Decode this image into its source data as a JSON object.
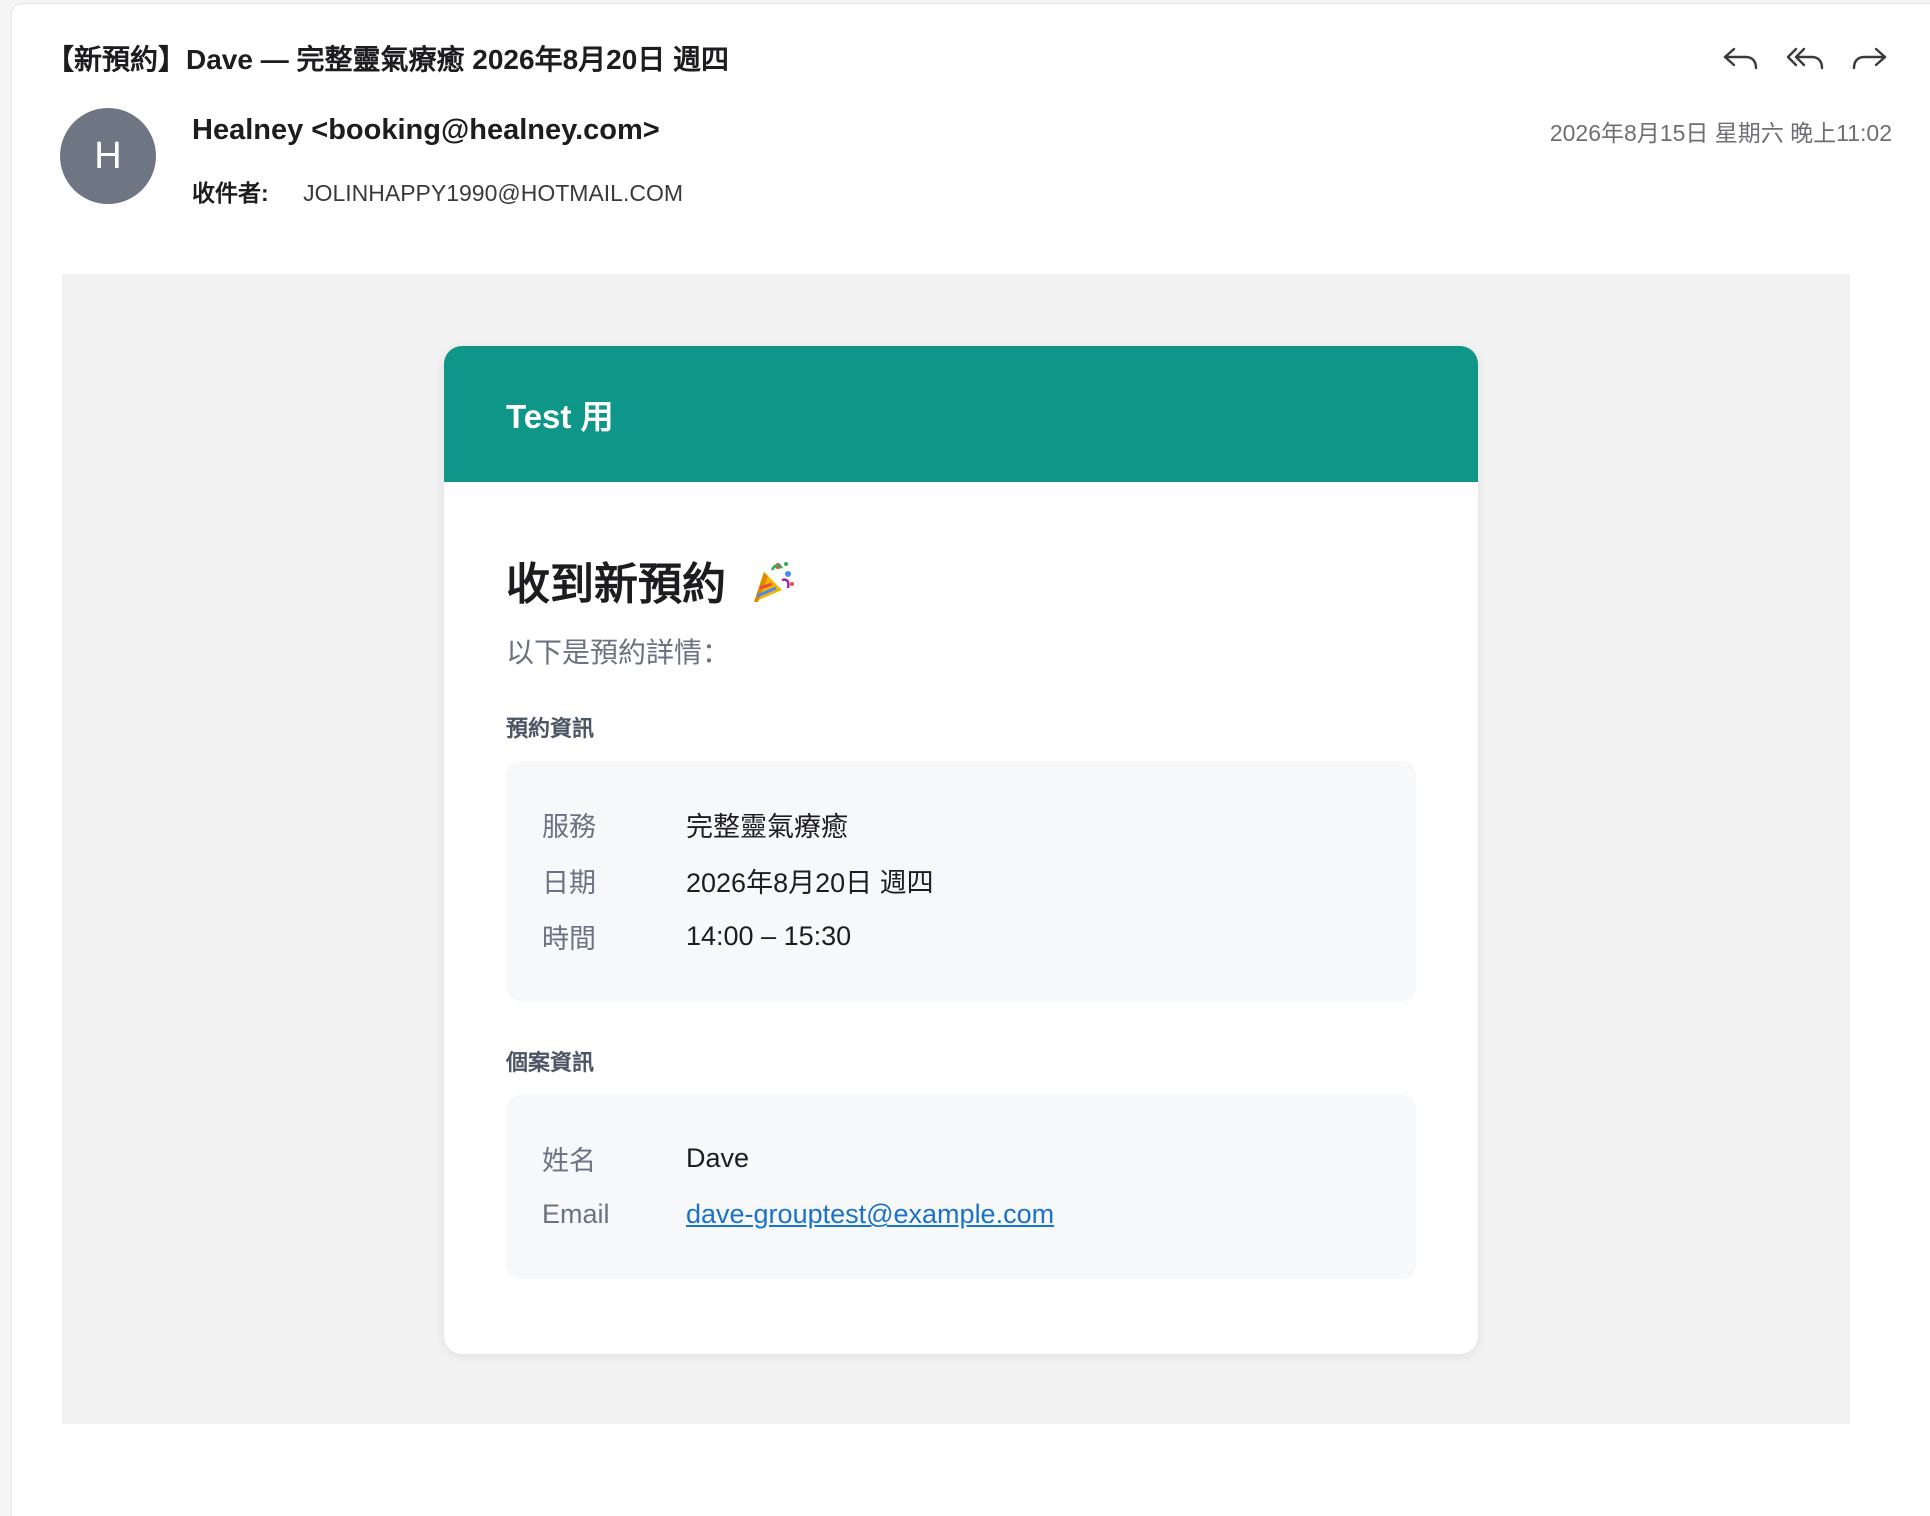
{
  "email": {
    "subject": "【新預約】Dave — 完整靈氣療癒 2026年8月20日 週四",
    "sender_initial": "H",
    "from": "Healney <booking@healney.com>",
    "to_label": "收件者:",
    "to_value": "JOLINHAPPY1990@HOTMAIL.COM",
    "datetime": "2026年8月15日 星期六 晚上11:02",
    "actions": [
      "reply-icon",
      "reply-all-icon",
      "forward-icon"
    ]
  },
  "card": {
    "header_title": "Test 用",
    "header_color": "#0e9688",
    "heading": "收到新預約",
    "heading_emoji": "party-popper-icon",
    "subheading": "以下是預約詳情：",
    "booking_section_title": "預約資訊",
    "booking_rows": [
      {
        "label": "服務",
        "value": "完整靈氣療癒"
      },
      {
        "label": "日期",
        "value": "2026年8月20日 週四"
      },
      {
        "label": "時間",
        "value": "14:00 – 15:30"
      }
    ],
    "client_section_title": "個案資訊",
    "client_rows": [
      {
        "label": "姓名",
        "value": "Dave"
      },
      {
        "label": "Email",
        "value": "dave-grouptest@example.com"
      }
    ],
    "link_color": "#1a73c8"
  }
}
